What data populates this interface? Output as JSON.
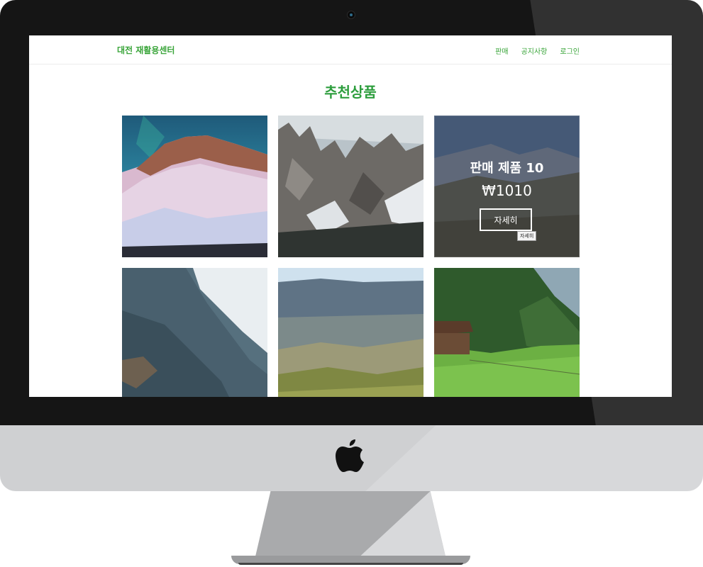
{
  "navbar": {
    "brand": "대전 재활용센터",
    "links": [
      "판매",
      "공지사항",
      "로그인"
    ]
  },
  "section_title": "추천상품",
  "hovered_product": {
    "title": "판매 제품 10",
    "price": "₩1010",
    "detail_button": "자세히",
    "tooltip": "자세히"
  },
  "colors": {
    "accent_green": "#3aa53a",
    "title_green": "#2e9e3e",
    "bezel": "#151515",
    "chin": "#cfd0d2"
  },
  "icons": [
    "apple-logo-icon",
    "camera-icon"
  ]
}
